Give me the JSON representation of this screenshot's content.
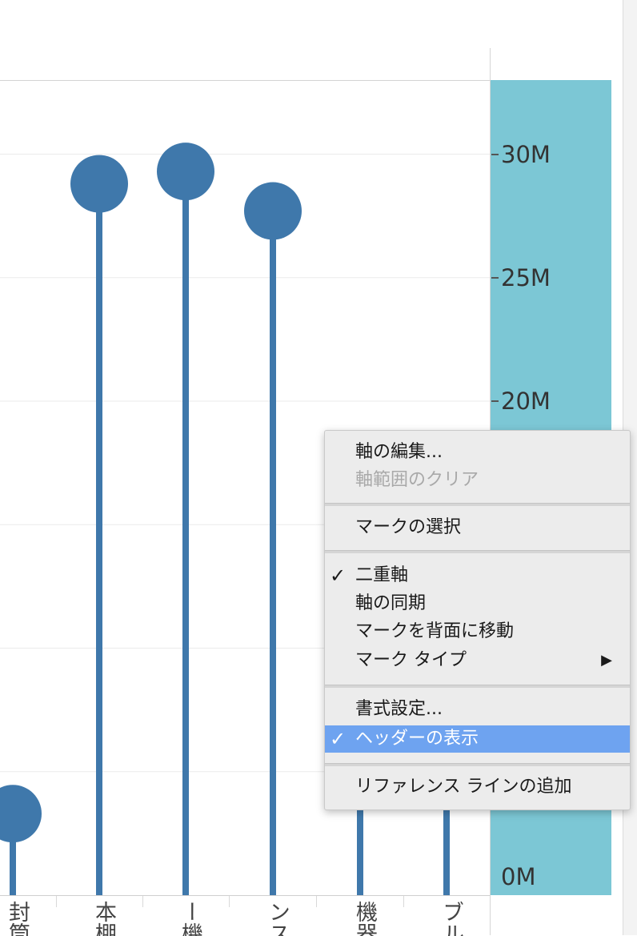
{
  "chart_data": {
    "type": "lollipop",
    "y_axis": {
      "min": 0,
      "max": 33,
      "ticks": [
        {
          "value": 30,
          "label": "30M"
        },
        {
          "value": 25,
          "label": "25M"
        },
        {
          "value": 20,
          "label": "20M"
        },
        {
          "value": 0,
          "label": "0M"
        }
      ],
      "gridlines": [
        5,
        10,
        15,
        20,
        25,
        30
      ]
    },
    "categories": [
      "封筒",
      "本棚",
      "ー機",
      "ンス",
      "機器",
      "ブル"
    ],
    "values": [
      3.3,
      28.8,
      29.3,
      27.7,
      7.0,
      7.0
    ],
    "color": "#3f78ab",
    "band_color": "#7cc7d5"
  },
  "menu": {
    "items": [
      {
        "label": "軸の編集...",
        "checked": false,
        "disabled": false,
        "highlighted": false,
        "submenu": false
      },
      {
        "label": "軸範囲のクリア",
        "checked": false,
        "disabled": true,
        "highlighted": false,
        "submenu": false
      },
      {
        "label": "マークの選択",
        "checked": false,
        "disabled": false,
        "highlighted": false,
        "submenu": false
      },
      {
        "label": "二重軸",
        "checked": true,
        "disabled": false,
        "highlighted": false,
        "submenu": false
      },
      {
        "label": "軸の同期",
        "checked": false,
        "disabled": false,
        "highlighted": false,
        "submenu": false
      },
      {
        "label": "マークを背面に移動",
        "checked": false,
        "disabled": false,
        "highlighted": false,
        "submenu": false
      },
      {
        "label": "マーク タイプ",
        "checked": false,
        "disabled": false,
        "highlighted": false,
        "submenu": true
      },
      {
        "label": "書式設定...",
        "checked": false,
        "disabled": false,
        "highlighted": false,
        "submenu": false
      },
      {
        "label": "ヘッダーの表示",
        "checked": true,
        "disabled": false,
        "highlighted": true,
        "submenu": false
      },
      {
        "label": "リファレンス ラインの追加",
        "checked": false,
        "disabled": false,
        "highlighted": false,
        "submenu": false
      }
    ],
    "check_glyph": "✓",
    "submenu_glyph": "▶"
  }
}
